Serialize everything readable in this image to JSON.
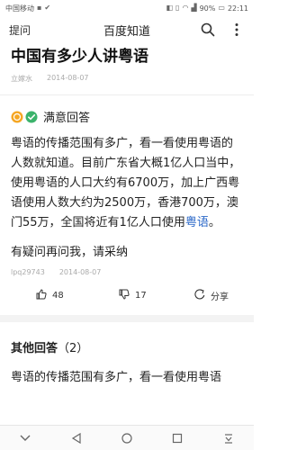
{
  "status_bar": {
    "carrier": "中国移动",
    "battery": "90%",
    "time": "22:11"
  },
  "nav": {
    "back_label": "提问",
    "title": "百度知道"
  },
  "question": {
    "title": "中国有多少人讲粤语",
    "author": "立嫁水",
    "date": "2014-08-07"
  },
  "best_answer": {
    "label": "满意回答",
    "text_part1": "粤语的传播范围有多广，看一看使用粤语的人数就知道。目前广东省大概1亿人口当中，使用粤语的人口大约有6700万，加上广西粤语使用人数大约为2500万，香港700万，澳门55万，全国将近有1亿人口使用",
    "link": "粤语",
    "text_part2": "。",
    "followup": "有疑问再问我，请采纳",
    "author": "lpq29743",
    "date": "2014-08-07",
    "likes": "48",
    "dislikes": "17",
    "share_label": "分享"
  },
  "other_answers": {
    "label": "其他回答",
    "count": "（2）",
    "preview": "粤语的传播范围有多广，看一看使用粤语"
  },
  "colors": {
    "accent_link": "#2b68c8",
    "badge_orange": "#f5a623",
    "badge_green": "#3bb36b"
  }
}
